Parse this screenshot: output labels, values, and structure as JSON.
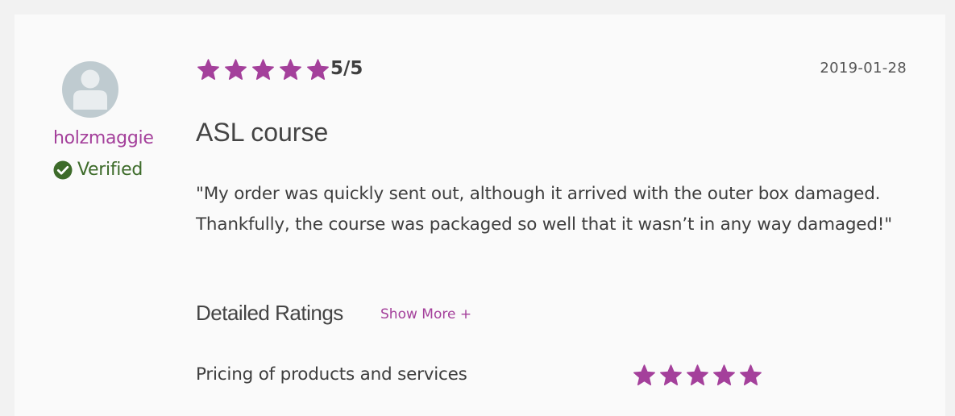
{
  "colors": {
    "accent": "#a4409b",
    "verified": "#3d6b2a",
    "card": "#fafafa",
    "page": "#f2f2f2",
    "avatar": "#bfcbd0",
    "text": "#3e3e3e"
  },
  "reviewer": {
    "name": "holzmaggie",
    "verified_label": "Verified",
    "avatar_icon": "user-silhouette-icon",
    "verified_icon": "check-circle-icon"
  },
  "review": {
    "rating": 5,
    "rating_max": 5,
    "score_text": "5/5",
    "date": "2019-01-28",
    "title": "ASL course",
    "body": "\"My order was quickly sent out, although it arrived with the outer box damaged. Thankfully, the course was packaged so well that it wasn’t in any way damaged!\""
  },
  "detailed_ratings": {
    "title": "Detailed Ratings",
    "show_more_label": "Show More +",
    "items": [
      {
        "label": "Pricing of products and services",
        "rating": 5,
        "rating_max": 5
      }
    ]
  }
}
